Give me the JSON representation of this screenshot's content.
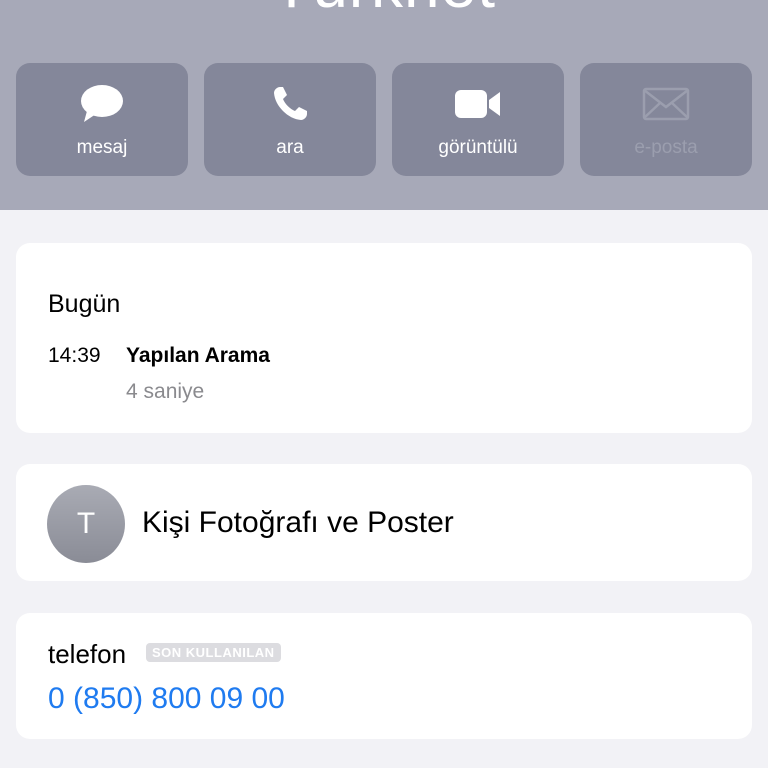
{
  "header": {
    "contact_name": "Türknet",
    "background": "#a7a9b8",
    "actions": [
      {
        "label": "mesaj",
        "icon": "message-bubble-icon",
        "enabled": true
      },
      {
        "label": "ara",
        "icon": "phone-icon",
        "enabled": true
      },
      {
        "label": "görüntülü",
        "icon": "video-camera-icon",
        "enabled": true
      },
      {
        "label": "e-posta",
        "icon": "mail-icon",
        "enabled": false
      }
    ]
  },
  "recents": {
    "day": "Bugün",
    "entries": [
      {
        "time": "14:39",
        "type": "Yapılan Arama",
        "duration": "4 saniye"
      }
    ]
  },
  "poster": {
    "avatar_initial": "T",
    "label": "Kişi Fotoğrafı ve Poster"
  },
  "phone": {
    "label": "telefon",
    "badge": "SON KULLANILAN",
    "number": "0 (850) 800 09 00",
    "link_color": "#1f7bf0"
  }
}
